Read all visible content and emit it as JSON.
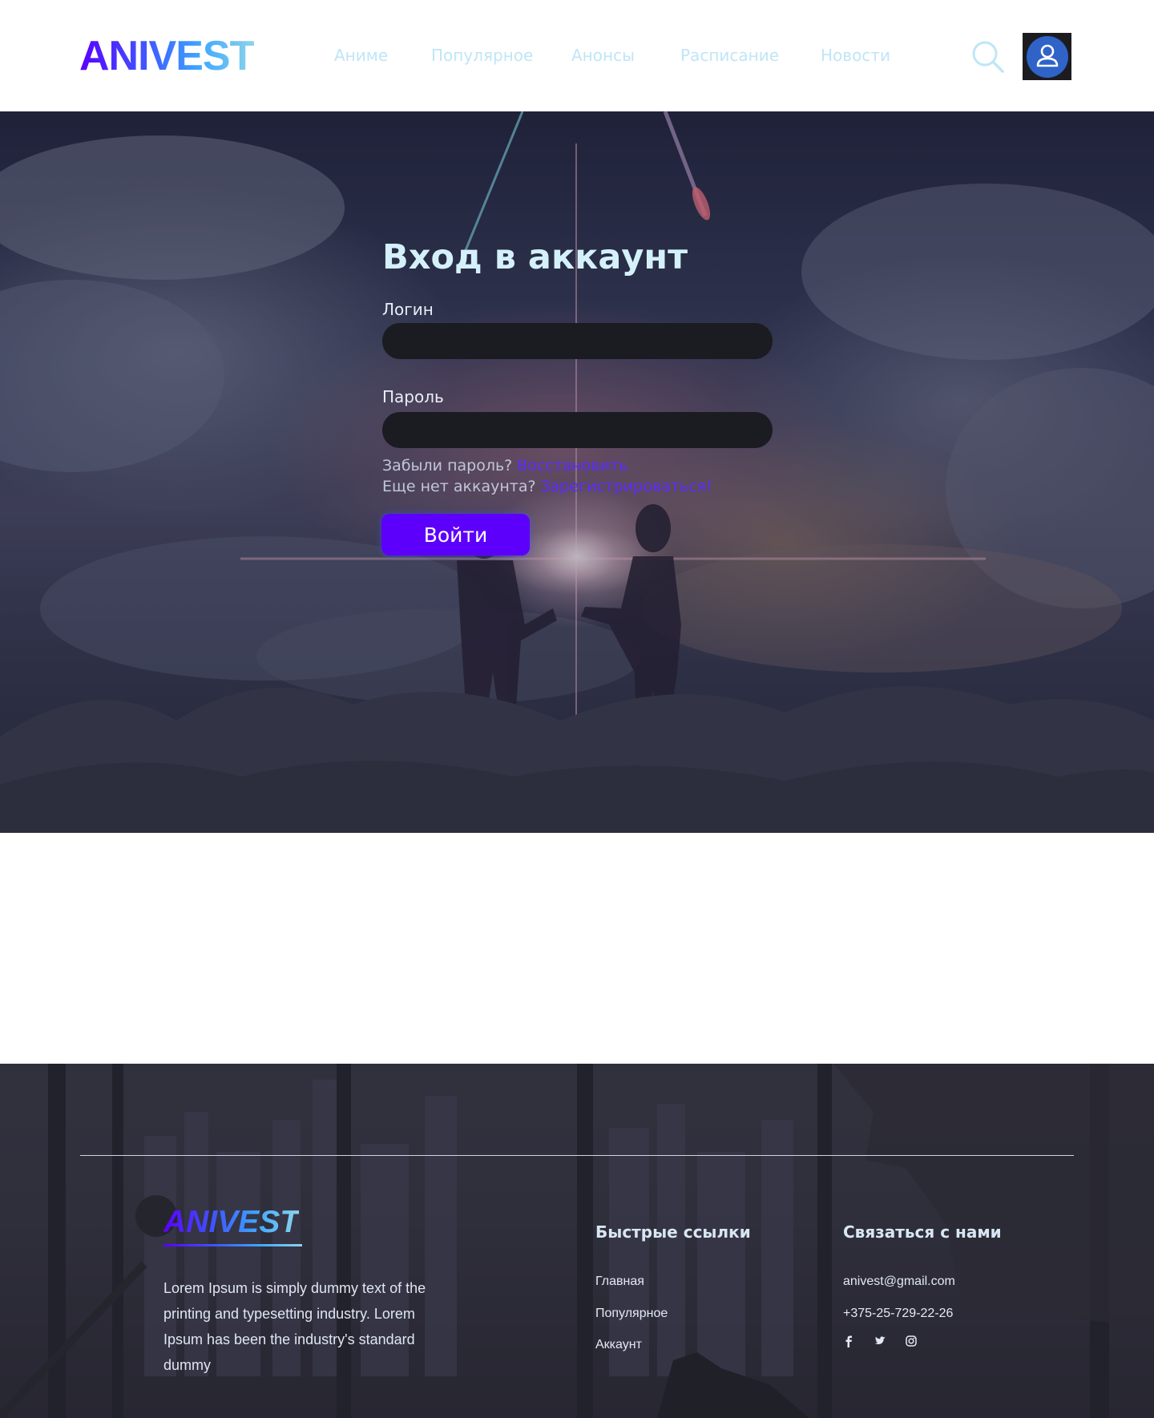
{
  "header": {
    "logo": "ANIVEST",
    "nav": [
      "Аниме",
      "Популярное",
      "Анонсы",
      "Расписание",
      "Новости"
    ],
    "icons": {
      "search": "search-icon",
      "account": "user-icon"
    }
  },
  "login": {
    "title": "Вход в аккаунт",
    "login_label": "Логин",
    "login_value": "",
    "password_label": "Пароль",
    "password_value": "",
    "forgot_text": "Забыли пароль?",
    "forgot_link": "Восстановить",
    "no_account_text": "Еще нет аккаунта?",
    "register_link": "Зарегистрироваться!",
    "submit_label": "Войти"
  },
  "footer": {
    "logo": "ANIVEST",
    "about": "Lorem Ipsum is simply dummy text of the printing and typesetting industry. Lorem Ipsum has been the industry's standard dummy",
    "quick_links_heading": "Быстрые ссылки",
    "quick_links": [
      "Главная",
      "Популярное",
      "Аккаунт"
    ],
    "contact_heading": "Связаться с нами",
    "email": "anivest@gmail.com",
    "phone": "+375-25-729-22-26",
    "social": [
      "facebook-icon",
      "twitter-icon",
      "instagram-icon"
    ]
  },
  "colors": {
    "accent": "#5d00fb",
    "link": "#5a2cff",
    "nav_text": "#bfe6f6",
    "input_bg": "#1b1c21"
  }
}
